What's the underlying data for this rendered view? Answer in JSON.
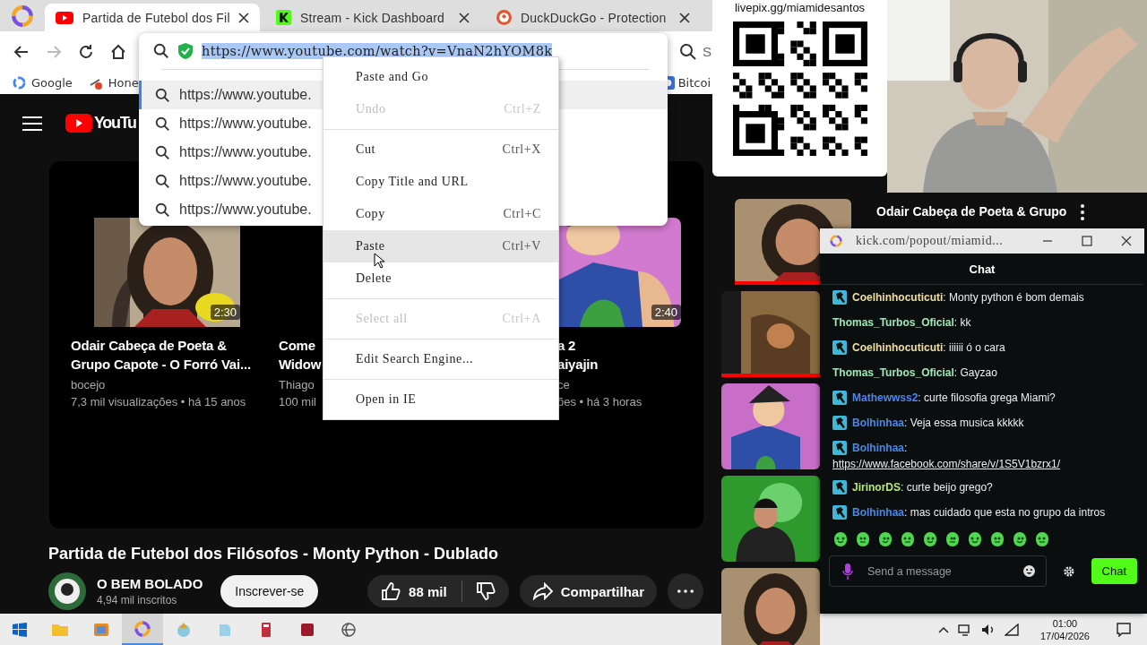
{
  "browser": {
    "tabs": [
      {
        "kind": "youtube",
        "title": "Partida de Futebol dos Fil",
        "selected": true
      },
      {
        "kind": "kick",
        "title": "Stream - Kick Dashboard",
        "selected": false
      },
      {
        "kind": "duckduckgo",
        "title": "DuckDuckGo - Protection",
        "selected": false
      }
    ],
    "nav_buttons": [
      {
        "kind": "back",
        "disabled": false
      },
      {
        "kind": "forward",
        "disabled": true
      },
      {
        "kind": "reload",
        "disabled": false
      },
      {
        "kind": "home",
        "disabled": false
      }
    ],
    "search_fragment": "S",
    "bookmarks": [
      {
        "kind": "google",
        "label": "Google"
      },
      {
        "kind": "honey",
        "label": "Hone"
      },
      {
        "kind": "bitcoin",
        "label": "Bitcoi"
      }
    ]
  },
  "address_dropdown": {
    "url": "https://www.youtube.com/watch?v=VnaN2hYOM8k",
    "url_selected": true,
    "suggestions": [
      {
        "text": "https://www.youtube.",
        "selected": true
      },
      {
        "text": "https://www.youtube.",
        "selected": false
      },
      {
        "text": "https://www.youtube.",
        "selected": false
      },
      {
        "text": "https://www.youtube.",
        "selected": false
      },
      {
        "text": "https://www.youtube.",
        "selected": false
      }
    ]
  },
  "context_menu": {
    "groups": [
      [
        {
          "label": "Paste and Go",
          "disabled": false,
          "selected": false
        },
        {
          "label": "Undo",
          "shortcut": "Ctrl+Z",
          "disabled": true,
          "selected": false
        }
      ],
      [
        {
          "label": "Cut",
          "shortcut": "Ctrl+X",
          "disabled": false,
          "selected": false
        },
        {
          "label": "Copy Title and URL",
          "disabled": false,
          "selected": false
        },
        {
          "label": "Copy",
          "shortcut": "Ctrl+C",
          "disabled": false,
          "selected": false
        },
        {
          "label": "Paste",
          "shortcut": "Ctrl+V",
          "disabled": false,
          "selected": true
        },
        {
          "label": "Delete",
          "disabled": false,
          "selected": false
        }
      ],
      [
        {
          "label": "Select all",
          "shortcut": "Ctrl+A",
          "disabled": true,
          "selected": false
        }
      ],
      [
        {
          "label": "Edit Search Engine...",
          "disabled": false,
          "selected": false
        }
      ],
      [
        {
          "label": "Open in IE",
          "disabled": false,
          "selected": false
        }
      ]
    ]
  },
  "youtube": {
    "logo_text": "YouTu",
    "end_screen": [
      {
        "kind": "picture",
        "duration": "2:30",
        "title_lines": [
          "Odair Cabeça de Poeta &",
          "Grupo Capote - O Forró Vai..."
        ],
        "channel": "bocejo",
        "meta": "7,3 mil visualizações • há 15 anos"
      },
      {
        "title_lines": [
          "Come",
          "Widow"
        ],
        "channel": "Thiago",
        "meta": "100 mil"
      },
      {
        "kind": "picture",
        "duration": "2:40",
        "title_lines": [
          "a 2",
          "aiyajin"
        ],
        "channel": "ce",
        "meta": "ões • há 3 horas"
      }
    ],
    "video_title": "Partida de Futebol dos Filósofos - Monty Python - Dublado",
    "channel": {
      "name": "O BEM BOLADO",
      "subscribers": "4,94 mil inscritos"
    },
    "subscribe_label": "Inscrever-se",
    "likes": "88 mil",
    "share_label": "Compartilhar",
    "related": [
      {
        "kind": "picture",
        "level": 1,
        "title_lines": [
          "Odair Cabeça de Poeta & Grupo"
        ]
      },
      {
        "kind": "picture",
        "level": 1
      },
      {
        "kind": "picture"
      },
      {
        "kind": "picture"
      },
      {
        "kind": "picture"
      }
    ]
  },
  "stream_overlay": {
    "qr_caption": "livepix.gg/miamidesantos"
  },
  "popout": {
    "title": "kick.com/popout/miamid...",
    "header": "Chat",
    "messages": [
      {
        "badge": true,
        "user": "Coelhinhocuticuti",
        "color": "#f0dfa0",
        "text": ": Monty python é bom demais"
      },
      {
        "badge": false,
        "user": "Thomas_Turbos_Oficial",
        "color": "#9be8b4",
        "text": ": kk"
      },
      {
        "badge": true,
        "user": "Coelhinhocuticuti",
        "color": "#f0dfa0",
        "text": ": iiiiii ó o cara"
      },
      {
        "badge": false,
        "user": "Thomas_Turbos_Oficial",
        "color": "#9be8b4",
        "text": ": Gayzao"
      },
      {
        "badge": true,
        "user": "Mathewwss2",
        "color": "#4c86e8",
        "text": ": curte filosofia grega Miami?"
      },
      {
        "badge": true,
        "user": "Bolhinhaa",
        "color": "#4c86e8",
        "text": ": Veja essa musica kkkkk"
      },
      {
        "badge": true,
        "user": "Bolhinhaa",
        "color": "#4c86e8",
        "text": ":",
        "link": "https://www.facebook.com/share/v/1S5V1bzrx1/"
      },
      {
        "badge": true,
        "user": "JirinorDS",
        "color": "#b4e87a",
        "text": ": curte beijo grego?"
      },
      {
        "badge": true,
        "user": "Bolhinhaa",
        "color": "#4c86e8",
        "text": ": mas cuidado que esta no grupo da intros"
      }
    ],
    "input_placeholder": "Send a message",
    "send_label": "Chat"
  },
  "taskbar": {
    "apps": [
      {
        "kind": "folder",
        "selected": false
      },
      {
        "kind": "media",
        "selected": false
      },
      {
        "kind": "browser",
        "selected": true
      },
      {
        "kind": "game",
        "selected": false
      },
      {
        "kind": "notes",
        "selected": false
      },
      {
        "kind": "calculator",
        "selected": false
      },
      {
        "kind": "editor",
        "selected": false
      },
      {
        "kind": "globe",
        "selected": false
      }
    ],
    "time": "01:00",
    "date": "17/04/2026"
  }
}
